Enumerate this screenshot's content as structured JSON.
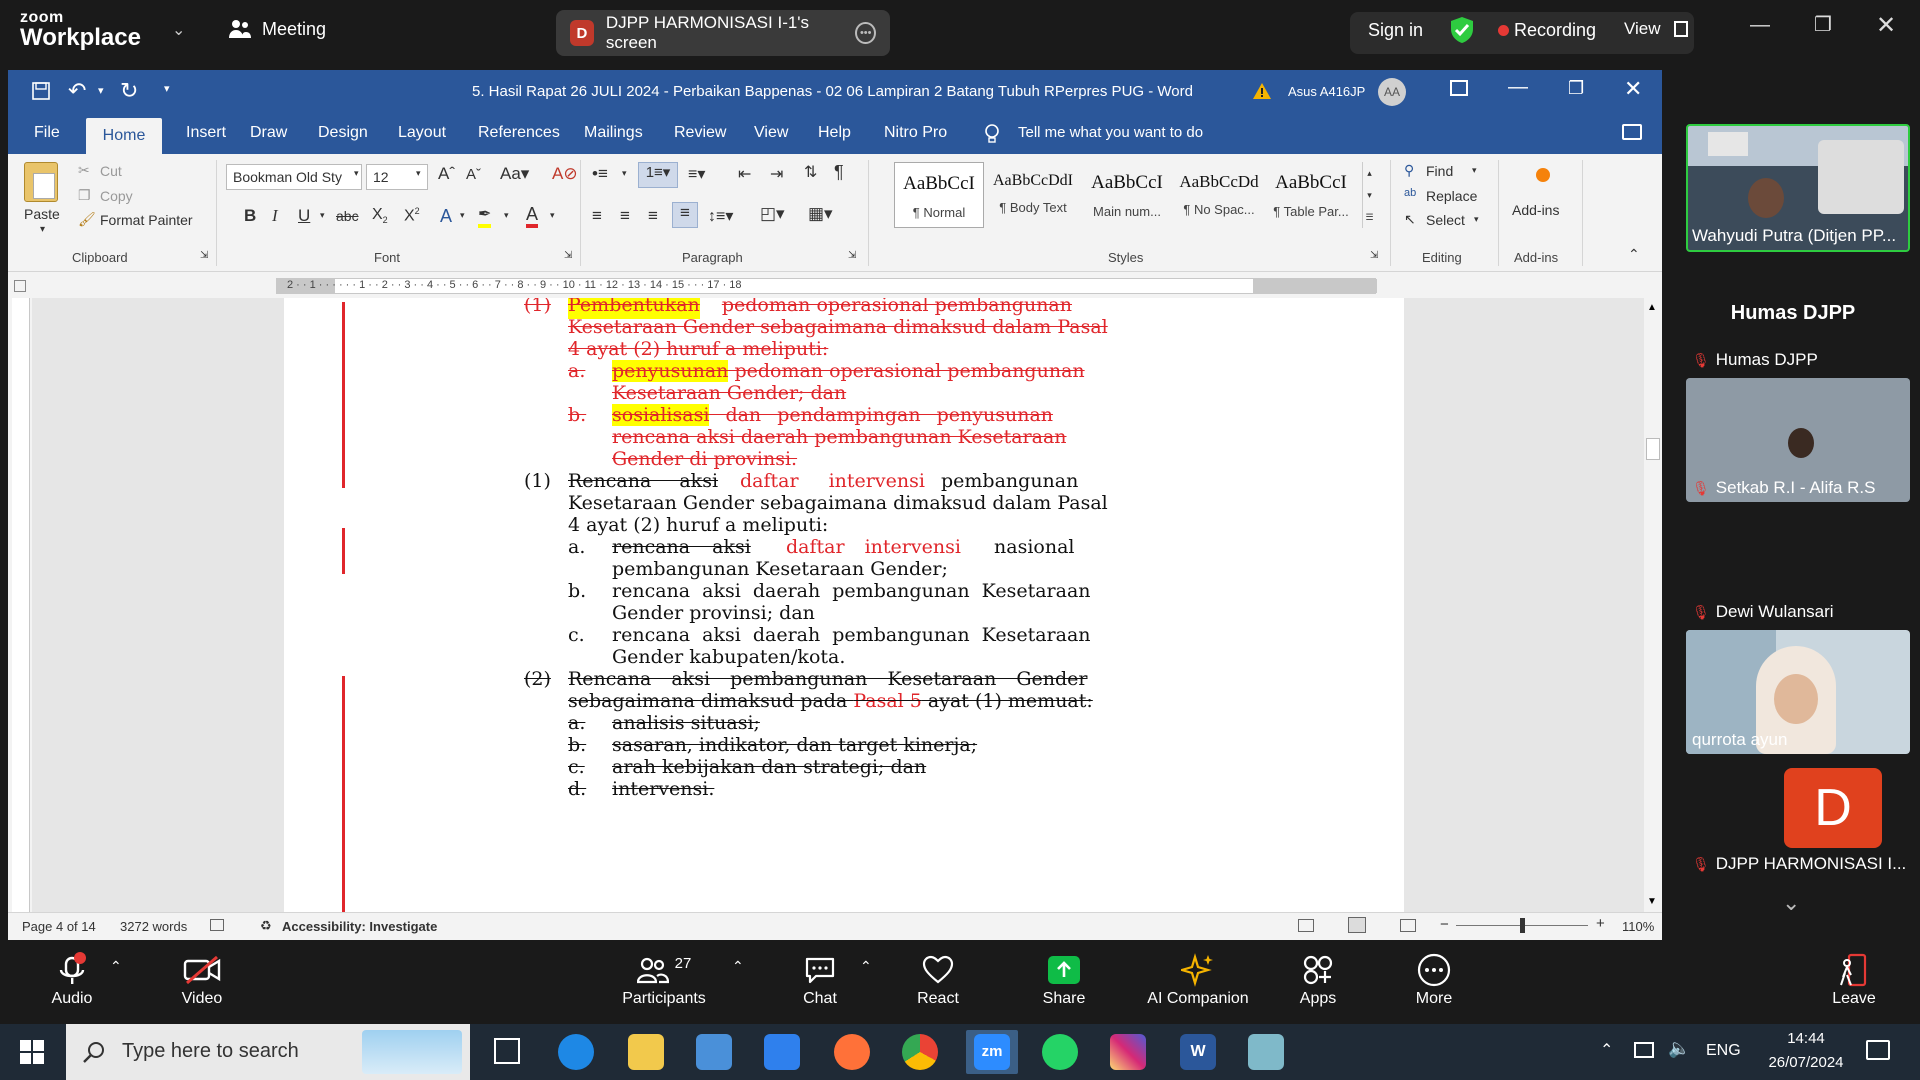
{
  "zoom": {
    "brand_top": "zoom",
    "brand_bottom": "Workplace",
    "meeting_label": "Meeting",
    "screen_share_initial": "D",
    "screen_share_label": "DJPP HARMONISASI I-1's screen",
    "sign_in": "Sign in",
    "recording": "Recording",
    "view": "View"
  },
  "word": {
    "title": "5. Hasil Rapat 26 JULI 2024 - Perbaikan Bappenas - 02 06 Lampiran 2 Batang Tubuh RPerpres PUG  -  Word",
    "user": "Asus A416JP",
    "user_initials": "AA",
    "tabs": [
      "File",
      "Home",
      "Insert",
      "Draw",
      "Design",
      "Layout",
      "References",
      "Mailings",
      "Review",
      "View",
      "Help",
      "Nitro Pro"
    ],
    "tell_me": "Tell me what you want to do",
    "clipboard": {
      "paste": "Paste",
      "cut": "Cut",
      "copy": "Copy",
      "format_painter": "Format Painter",
      "label": "Clipboard"
    },
    "font": {
      "name": "Bookman Old Sty",
      "size": "12",
      "label": "Font"
    },
    "paragraph_label": "Paragraph",
    "styles": [
      {
        "preview": "AaBbCcI",
        "name": "¶ Normal"
      },
      {
        "preview": "AaBbCcDdI",
        "name": "¶ Body Text"
      },
      {
        "preview": "AaBbCcI",
        "name": "Main num..."
      },
      {
        "preview": "AaBbCcDd",
        "name": "¶ No Spac..."
      },
      {
        "preview": "AaBbCcI",
        "name": "¶ Table Par..."
      }
    ],
    "styles_label": "Styles",
    "editing": {
      "find": "Find",
      "replace": "Replace",
      "select": "Select",
      "label": "Editing"
    },
    "addins": {
      "button": "Add-ins",
      "label": "Add-ins"
    },
    "status": {
      "page": "Page 4 of 14",
      "words": "3272 words",
      "accessibility": "Accessibility: Investigate",
      "zoom": "110%"
    }
  },
  "doc": {
    "l1a": "(1)",
    "l1b": "Pembentukan",
    "l1c": "pedoman operasional pembangunan",
    "l2": "Kesetaraan Gender sebagaimana dimaksud dalam Pasal",
    "l3": "4 ayat (2) huruf a meliputi:",
    "l4a": "a.",
    "l4b": "penyusunan",
    "l4c": " pedoman operasional pembangunan",
    "l5": "Kesetaraan Gender; dan",
    "l6a": "b.",
    "l6b": "sosialisasi",
    "l6c": " dan pendampingan penyusunan",
    "l7": "rencana aksi daerah pembangunan Kesetaraan",
    "l8": "Gender di provinsi.",
    "l9a": "(1)",
    "l9b": "Rencana aksi",
    "l9c": "daftar intervensi",
    "l9d": "pembangunan",
    "l10": "Kesetaraan Gender sebagaimana dimaksud dalam Pasal",
    "l11": "4 ayat (2) huruf a meliputi:",
    "l12a": "a.",
    "l12b": "rencana aksi",
    "l12c": "daftar intervensi",
    "l12d": "nasional",
    "l13": "pembangunan Kesetaraan Gender;",
    "l14a": "b.",
    "l14b": "rencana aksi daerah pembangunan Kesetaraan",
    "l15": "Gender provinsi; dan",
    "l16a": "c.",
    "l16b": "rencana aksi daerah pembangunan Kesetaraan",
    "l17": "Gender kabupaten/kota.",
    "l18a": "(2)",
    "l18b": "Rencana aksi pembangunan Kesetaraan Gender",
    "l19a": "sebagaimana dimaksud pada ",
    "l19b": "Pasal 5",
    "l19c": " ayat (1) memuat:",
    "l20a": "a.",
    "l20b": "analisis situasi;",
    "l21a": "b.",
    "l21b": "sasaran, indikator, dan target kinerja;",
    "l22a": "c.",
    "l22b": "arah kebijakan dan strategi; dan",
    "l23a": "d.",
    "l23b": "intervensi."
  },
  "panel": {
    "top_video_name": "Wahyudi Putra (Ditjen PP...",
    "heading": "Humas DJPP",
    "humas": "Humas DJPP",
    "setkab": "Setkab R.I - Alifa R.S",
    "dewi": "Dewi Wulansari",
    "qurrota": "qurrota ayun",
    "djpp_initial": "D",
    "djpp": "DJPP HARMONISASI I..."
  },
  "toolbar": {
    "audio": "Audio",
    "video": "Video",
    "participants": "Participants",
    "participants_count": "27",
    "chat": "Chat",
    "react": "React",
    "share": "Share",
    "ai": "AI Companion",
    "apps": "Apps",
    "more": "More",
    "leave": "Leave"
  },
  "taskbar": {
    "search_placeholder": "Type here to search",
    "lang": "ENG",
    "time": "14:44",
    "date": "26/07/2024"
  },
  "colors": {
    "word_blue": "#2b579a",
    "track_red": "#e0262b",
    "zoom_dark": "#1a1a1a",
    "share_green": "#0fbc47"
  }
}
